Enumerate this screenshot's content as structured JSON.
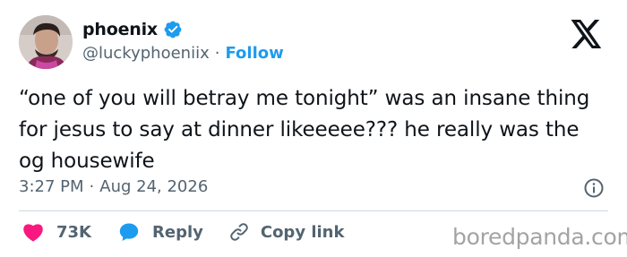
{
  "user": {
    "display_name": "phoenix",
    "handle": "@luckyphoeniix",
    "separator": "·",
    "follow_label": "Follow"
  },
  "tweet": {
    "text": "“one of you will betray me tonight” was an insane thing for jesus to say at dinner likeeeee??? he really was the og housewife",
    "time": "3:27 PM",
    "separator": "·",
    "date": "Aug 24, 2026"
  },
  "actions": {
    "likes_count": "73K",
    "reply_label": "Reply",
    "copy_link_label": "Copy link"
  },
  "watermark": "boredpanda.com",
  "colors": {
    "accent": "#1d9bf0",
    "like": "#f91880",
    "muted": "#536471",
    "text": "#0f1419"
  },
  "icons": [
    "verified-badge-icon",
    "x-logo-icon",
    "info-icon",
    "heart-icon",
    "reply-bubble-icon",
    "link-icon"
  ]
}
